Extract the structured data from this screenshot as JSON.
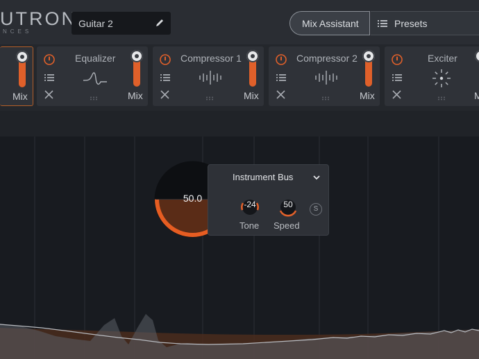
{
  "header": {
    "logo_text": "UTRON",
    "logo_sub": "NCES",
    "preset_name": "Guitar 2",
    "mix_assistant_label": "Mix Assistant",
    "presets_label": "Presets"
  },
  "modules": [
    {
      "title": "",
      "mix_label": "Mix",
      "icon": "none",
      "mix_level": 0.85
    },
    {
      "title": "Equalizer",
      "mix_label": "Mix",
      "icon": "eq-curve-icon",
      "mix_level": 0.85
    },
    {
      "title": "Compressor 1",
      "mix_label": "Mix",
      "icon": "compressor-icon",
      "mix_level": 0.85
    },
    {
      "title": "Compressor 2",
      "mix_label": "Mix",
      "icon": "compressor-icon",
      "mix_level": 0.85
    },
    {
      "title": "Exciter",
      "mix_label": "M",
      "icon": "exciter-icon",
      "mix_level": 0.85
    }
  ],
  "assistant_panel": {
    "dial_value": "50.0",
    "dial_level": 0.5,
    "bus_label": "Instrument Bus",
    "tone_value": "-24",
    "tone_label": "Tone",
    "speed_value": "50",
    "speed_label": "Speed",
    "s_label": "S"
  },
  "colors": {
    "accent": "#e0602a",
    "background": "#181b20",
    "panel": "#2e3137"
  }
}
